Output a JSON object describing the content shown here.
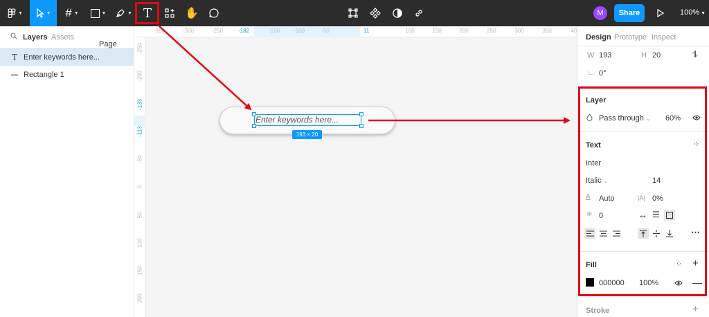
{
  "toolbar": {
    "share_label": "Share",
    "avatar_initial": "M",
    "zoom_label": "100%"
  },
  "left_panel": {
    "tabs": {
      "layers": "Layers",
      "assets": "Assets"
    },
    "page_label": "Page 1",
    "layers": [
      {
        "name": "Enter keywords here...",
        "type": "text",
        "selected": true
      },
      {
        "name": "Rectangle 1",
        "type": "rectangle",
        "selected": false
      }
    ]
  },
  "rulers": {
    "top_ticks": [
      {
        "label": "-350",
        "highlight": false
      },
      {
        "label": "-300",
        "highlight": false
      },
      {
        "label": "-250",
        "highlight": false
      },
      {
        "label": "-182",
        "highlight": true
      },
      {
        "label": "-150",
        "highlight": false
      },
      {
        "label": "-100",
        "highlight": false
      },
      {
        "label": "-50",
        "highlight": false
      },
      {
        "label": "11",
        "highlight": true
      },
      {
        "label": "100",
        "highlight": false
      },
      {
        "label": "150",
        "highlight": false
      },
      {
        "label": "200",
        "highlight": false
      },
      {
        "label": "250",
        "highlight": false
      },
      {
        "label": "300",
        "highlight": false
      },
      {
        "label": "350",
        "highlight": false
      },
      {
        "label": "40",
        "highlight": false
      }
    ],
    "left_ticks": [
      {
        "label": "-250",
        "highlight": false
      },
      {
        "label": "-200",
        "highlight": false
      },
      {
        "label": "-133",
        "highlight": true
      },
      {
        "label": "-113",
        "highlight": true
      },
      {
        "label": "-50",
        "highlight": false
      },
      {
        "label": "0",
        "highlight": false
      },
      {
        "label": "50",
        "highlight": false
      },
      {
        "label": "100",
        "highlight": false
      },
      {
        "label": "150",
        "highlight": false
      },
      {
        "label": "200",
        "highlight": false
      }
    ]
  },
  "canvas": {
    "text_content": "Enter keywords here...",
    "dimension_badge": "193 × 20"
  },
  "right_panel": {
    "tabs": {
      "design": "Design",
      "prototype": "Prototype",
      "inspect": "Inspect"
    },
    "w_label": "W",
    "w_value": "193",
    "h_label": "H",
    "h_value": "20",
    "rotation": "0°",
    "layer": {
      "title": "Layer",
      "blend_mode": "Pass through",
      "opacity": "60%"
    },
    "text": {
      "title": "Text",
      "font_family": "Inter",
      "font_style": "Italic",
      "font_size": "14",
      "line_height": "Auto",
      "letter_spacing": "0%",
      "paragraph_spacing": "0"
    },
    "fill": {
      "title": "Fill",
      "color_hex": "000000",
      "opacity": "100%"
    },
    "stroke": {
      "title": "Stroke"
    }
  },
  "colors": {
    "accent": "#0d99ff",
    "highlight_red": "#e30613",
    "toolbar_bg": "#2c2c2c",
    "avatar": "#9747ff"
  }
}
